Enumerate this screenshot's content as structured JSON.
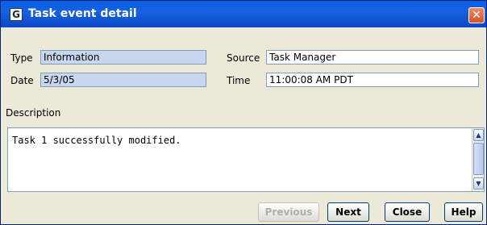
{
  "window": {
    "title": "Task event detail",
    "app_icon": "app-logo-icon",
    "close_glyph": "✕"
  },
  "fields": {
    "type": {
      "label": "Type",
      "value": "Information"
    },
    "date": {
      "label": "Date",
      "value": "5/3/05"
    },
    "source": {
      "label": "Source",
      "value": "Task Manager"
    },
    "time": {
      "label": "Time",
      "value": "11:00:08 AM PDT"
    }
  },
  "description": {
    "label": "Description",
    "text": "Task 1 successfully modified."
  },
  "scrollbar": {
    "up_glyph": "▲",
    "down_glyph": "▼"
  },
  "buttons": {
    "previous": {
      "label": "Previous",
      "enabled": false
    },
    "next": {
      "label": "Next",
      "enabled": true
    },
    "close": {
      "label": "Close",
      "enabled": true
    },
    "help": {
      "label": "Help",
      "enabled": true
    }
  },
  "colors": {
    "titlebar": "#0a5fe8",
    "readonly_field": "#c9d7ee",
    "close_button": "#d5522a",
    "dialog_bg": "#ece9d8"
  }
}
